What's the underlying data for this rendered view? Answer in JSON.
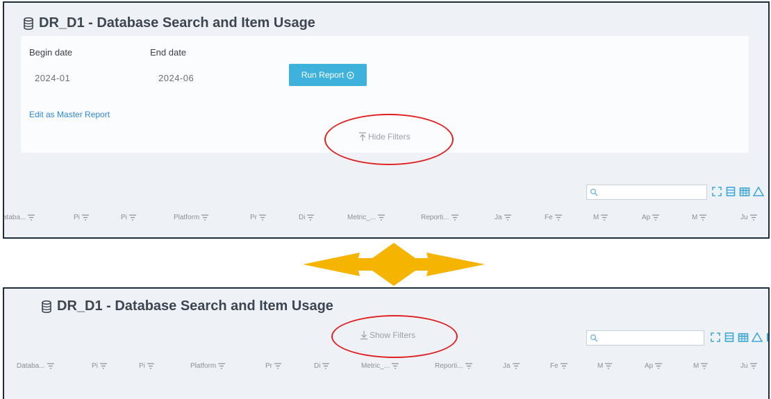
{
  "report_title": "DR_D1 - Database Search and Item Usage",
  "filters": {
    "begin_label": "Begin date",
    "begin_value": "2024-01",
    "end_label": "End date",
    "end_value": "2024-06",
    "run_button": "Run Report",
    "edit_link": "Edit as Master Report",
    "hide_filters": "Hide Filters",
    "show_filters": "Show Filters"
  },
  "search": {
    "placeholder": ""
  },
  "toolbar_icons": [
    "fullscreen-icon",
    "column-list-icon",
    "table-icon",
    "chart-icon"
  ],
  "columns_top": [
    "ataba...",
    "Pi",
    "Pi",
    "Platform",
    "Pr",
    "Di",
    "Metric_...",
    "Reporti...",
    "Ja",
    "Fe",
    "M",
    "Ap",
    "M",
    "Ju"
  ],
  "columns_bottom": [
    "Databa...",
    "Pi",
    "Pi",
    "Platform",
    "Pr",
    "Di",
    "Metric_...",
    "Reporti...",
    "Ja",
    "Fe",
    "M",
    "Ap",
    "M",
    "Ju"
  ],
  "colors": {
    "accent": "#3fb2dc",
    "highlight": "#e02020",
    "arrow": "#f5b400",
    "link": "#2c87d6"
  }
}
